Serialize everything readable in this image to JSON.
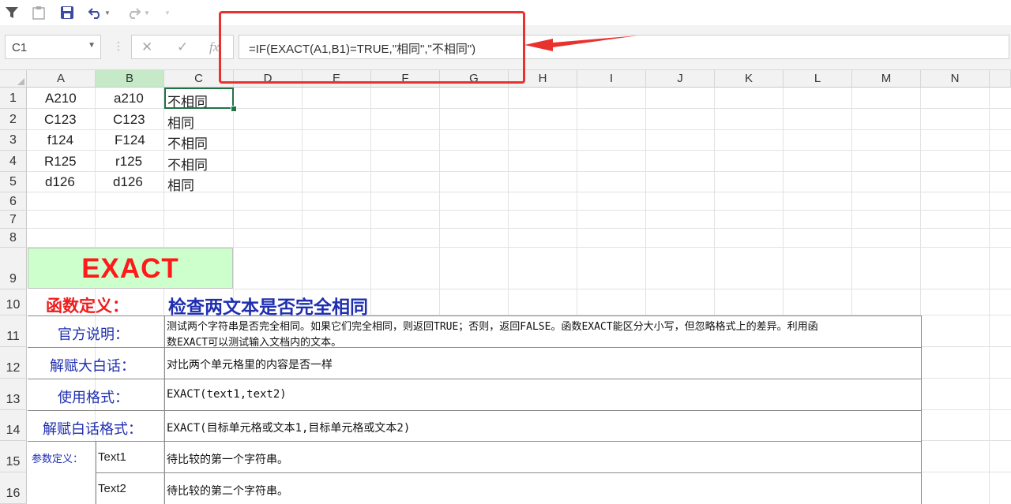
{
  "toolbar": {
    "icons": [
      "filter-icon",
      "paste-icon",
      "save-icon",
      "undo-icon",
      "dropdown-icon",
      "redo-icon",
      "dropdown-icon"
    ]
  },
  "formula_bar": {
    "name_box": "C1",
    "cancel_symbol": "✕",
    "confirm_symbol": "✓",
    "fx_symbol": "fx",
    "formula": "=IF(EXACT(A1,B1)=TRUE,\"相同\",\"不相同\")"
  },
  "columns": [
    "A",
    "B",
    "C",
    "D",
    "E",
    "F",
    "G",
    "H",
    "I",
    "J",
    "K",
    "L",
    "M",
    "N"
  ],
  "rows": [
    "1",
    "2",
    "3",
    "4",
    "5",
    "6",
    "7",
    "8",
    "9",
    "10",
    "11",
    "12",
    "13",
    "14",
    "15",
    "16"
  ],
  "cells": {
    "A1": "A210",
    "B1": "a210",
    "C1": "不相同",
    "A2": "C123",
    "B2": "C123",
    "C2": "相同",
    "A3": "f124",
    "B3": "F124",
    "C3": "不相同",
    "A4": "R125",
    "B4": "r125",
    "C4": "不相同",
    "A5": "d126",
    "B5": "d126",
    "C5": "相同"
  },
  "info": {
    "banner": "EXACT",
    "def_label": "函数定义：",
    "def_value": "检查两文本是否完全相同",
    "official_label": "官方说明：",
    "official_line1": "测试两个字符串是否完全相同。如果它们完全相同，则返回TRUE；否则，返回FALSE。函数EXACT能区分大小写，但忽略格式上的差异。利用函",
    "official_line2": "数EXACT可以测试输入文档内的文本。",
    "plain_label": "解赋大白话：",
    "plain_value": "对比两个单元格里的内容是否一样",
    "usage_label": "使用格式：",
    "usage_value": "EXACT(text1,text2)",
    "plain_format_label": "解赋白话格式：",
    "plain_format_value": "EXACT(目标单元格或文本1,目标单元格或文本2)",
    "param_label": "参数定义：",
    "param1_name": "Text1",
    "param1_desc": "待比较的第一个字符串。",
    "param2_name": "Text2",
    "param2_desc": "待比较的第二个字符串。"
  },
  "annotation_color": "#e8322e"
}
